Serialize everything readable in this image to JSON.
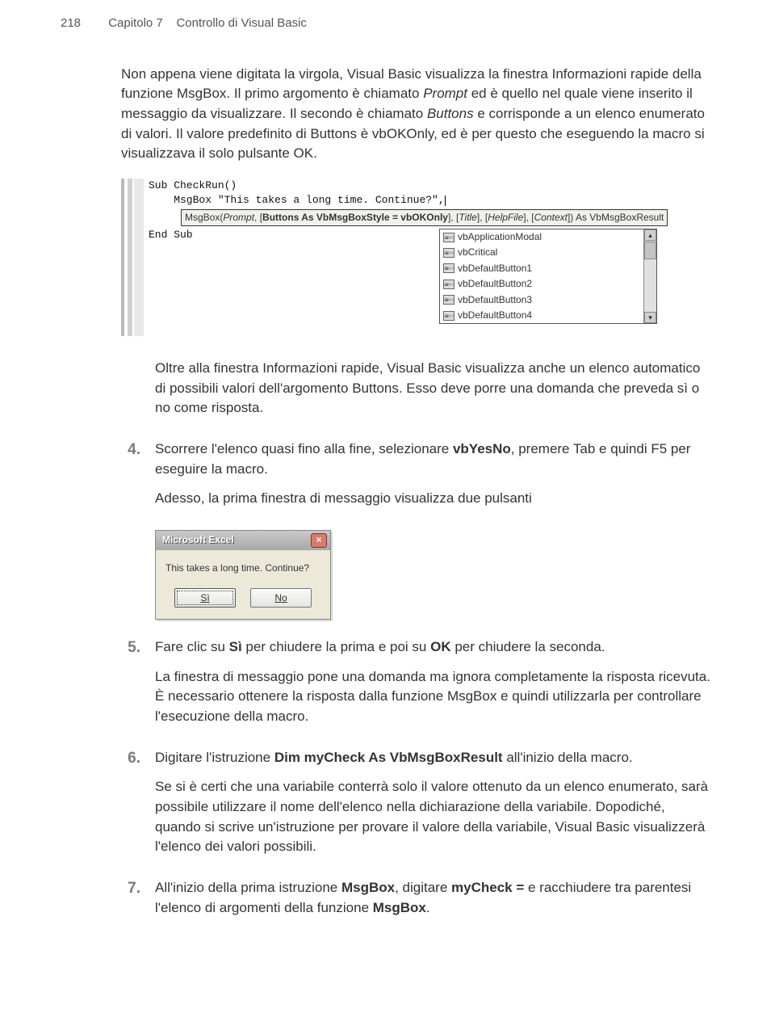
{
  "header": {
    "page_number": "218",
    "chapter": "Capitolo 7",
    "title": "Controllo di Visual Basic"
  },
  "intro": {
    "p1a": "Non appena viene digitata la virgola, Visual Basic visualizza la finestra Informazioni rapide della funzione MsgBox. Il primo argomento è chiamato ",
    "prompt": "Prompt",
    "p1b": " ed è quello nel quale viene inserito il messaggio da visualizzare. Il secondo è chiamato ",
    "buttons": "Buttons",
    "p1c": " e corrisponde a un elenco enumerato di valori. Il valore predefinito di Buttons è vbOKOnly, ed è per questo che eseguendo la macro si visualizzava il solo pulsante OK."
  },
  "code": {
    "line1": "Sub CheckRun()",
    "line2": "    MsgBox \"This takes a long time. Continue?\",",
    "tooltip": {
      "pre": "MsgBox(",
      "prompt_i": "Prompt",
      "mid1": ", [",
      "bold": "Buttons As VbMsgBoxStyle = vbOKOnly",
      "mid2": "], [",
      "title_i": "Title",
      "mid3": "], [",
      "help_i": "HelpFile",
      "mid4": "], [",
      "ctx_i": "Context",
      "tail": "]) As VbMsgBoxResult"
    },
    "line3": "End Sub",
    "dropdown_items": [
      "vbApplicationModal",
      "vbCritical",
      "vbDefaultButton1",
      "vbDefaultButton2",
      "vbDefaultButton3",
      "vbDefaultButton4"
    ]
  },
  "after_code": {
    "p2": "Oltre alla finestra Informazioni rapide, Visual Basic visualizza anche un elenco automatico di possibili valori dell'argomento Buttons. Esso deve porre una domanda che preveda sì o no come risposta."
  },
  "items": {
    "4": {
      "num": "4.",
      "p1a": "Scorrere l'elenco quasi fino alla fine, selezionare ",
      "vbyesno": "vbYesNo",
      "p1b": ", premere Tab e quindi F5 per eseguire la macro.",
      "p2": "Adesso, la prima finestra di messaggio visualizza due pulsanti"
    },
    "5": {
      "num": "5.",
      "p1a": "Fare clic su ",
      "si": "Sì",
      "p1b": " per chiudere la prima e poi su ",
      "ok": "OK",
      "p1c": " per chiudere la seconda.",
      "p2": "La finestra di messaggio pone una domanda ma ignora completamente la risposta ricevuta. È necessario ottenere la risposta dalla funzione MsgBox e quindi utilizzarla per controllare l'esecuzione della macro."
    },
    "6": {
      "num": "6.",
      "p1a": "Digitare l'istruzione ",
      "dim": "Dim myCheck As VbMsgBoxResult",
      "p1b": " all'inizio della macro.",
      "p2": "Se si è certi che una variabile conterrà solo il valore ottenuto da un elenco enumerato, sarà possibile utilizzare il nome dell'elenco nella dichiarazione della variabile. Dopodiché, quando si scrive un'istruzione per provare il valore della variabile, Visual Basic visualizzerà l'elenco dei valori possibili."
    },
    "7": {
      "num": "7.",
      "p1a": "All'inizio della prima istruzione ",
      "msgbox1": "MsgBox",
      "p1b": ", digitare ",
      "mycheck": "myCheck =",
      "p1c": " e racchiudere tra parentesi l'elenco di argomenti della funzione ",
      "msgbox2": "MsgBox",
      "p1d": "."
    }
  },
  "dialog": {
    "title": "Microsoft Excel",
    "message": "This takes a long time. Continue?",
    "btn_yes": "Sì",
    "btn_no": "No"
  }
}
